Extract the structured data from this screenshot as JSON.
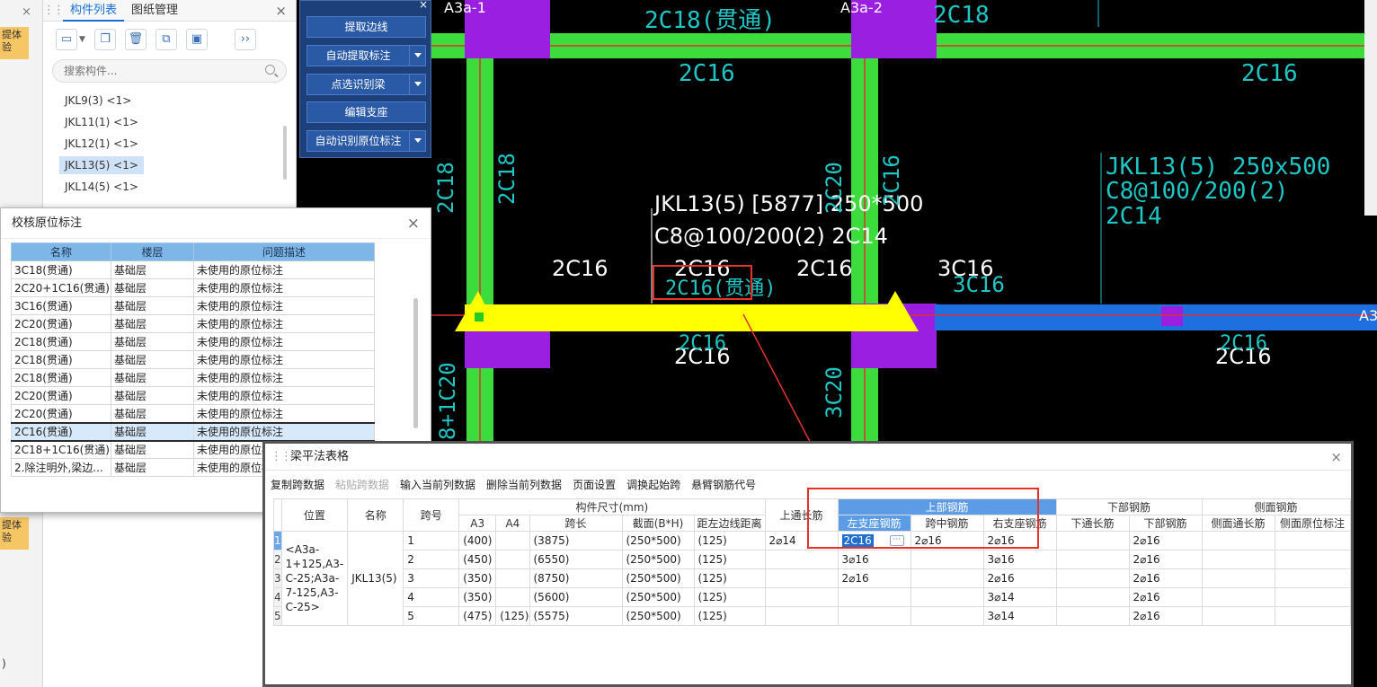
{
  "left_strip": {
    "badges": [
      "提体验",
      "提体验"
    ],
    "close": "×",
    "bottom_fragment": ")"
  },
  "component_panel": {
    "tabs": [
      "构件列表",
      "图纸管理"
    ],
    "close": "×",
    "search_placeholder": "搜索构件...",
    "items": [
      "JKL9(3) <1>",
      "JKL11(1) <1>",
      "JKL12(1) <1>",
      "JKL13(5) <1>",
      "JKL14(5) <1>"
    ],
    "selected_index": 3
  },
  "cad_commands": {
    "close": "×",
    "buttons": [
      "提取边线",
      "自动提取标注",
      "点选识别梁",
      "编辑支座",
      "自动识别原位标注"
    ]
  },
  "cad": {
    "axis_labels": [
      "A3a-1",
      "A3a-2",
      "A3"
    ],
    "white_texts": [
      "JKL13(5) [5877] 250*500",
      "C8@100/200(2) 2C14",
      "2C16",
      "2C16",
      "2C16",
      "3C16",
      "2C16",
      "2C16"
    ],
    "cyan_texts": [
      "2C18(贯通)",
      "2C18",
      "2C16",
      "2C16",
      "JKL13(5) 250x500",
      "C8@100/200(2)",
      "2C14",
      "2C18",
      "2C18",
      "2C20",
      "2C16",
      "2C16(贯通)",
      "3C16",
      "2C16",
      "2C16",
      "8+1C20",
      "3C20"
    ]
  },
  "check_dialog": {
    "title": "校核原位标注",
    "close": "×",
    "headers": [
      "名称",
      "楼层",
      "问题描述"
    ],
    "rows": [
      [
        "3C18(贯通)",
        "基础层",
        "未使用的原位标注"
      ],
      [
        "2C20+1C16(贯通)",
        "基础层",
        "未使用的原位标注"
      ],
      [
        "3C16(贯通)",
        "基础层",
        "未使用的原位标注"
      ],
      [
        "2C20(贯通)",
        "基础层",
        "未使用的原位标注"
      ],
      [
        "2C18(贯通)",
        "基础层",
        "未使用的原位标注"
      ],
      [
        "2C18(贯通)",
        "基础层",
        "未使用的原位标注"
      ],
      [
        "2C18(贯通)",
        "基础层",
        "未使用的原位标注"
      ],
      [
        "2C20(贯通)",
        "基础层",
        "未使用的原位标注"
      ],
      [
        "2C20(贯通)",
        "基础层",
        "未使用的原位标注"
      ],
      [
        "2C16(贯通)",
        "基础层",
        "未使用的原位标注"
      ],
      [
        "2C18+1C16(贯通)",
        "基础层",
        "未使用的原位标注"
      ],
      [
        "2.除注明外,梁边...",
        "基础层",
        "未使用的原位标注"
      ]
    ],
    "selected_index": 9
  },
  "beam_table": {
    "title": "梁平法表格",
    "close": "×",
    "menu": [
      "复制跨数据",
      "粘贴跨数据",
      "输入当前列数据",
      "删除当前列数据",
      "页面设置",
      "调换起始跨",
      "悬臂钢筋代号"
    ],
    "menu_disabled_index": 1,
    "headers": {
      "position": "位置",
      "name": "名称",
      "span_no": "跨号",
      "size_group": "构件尺寸(mm)",
      "a3": "A3",
      "a4": "A4",
      "span_len": "跨长",
      "section": "截面(B*H)",
      "edge_dist": "距左边线距离",
      "top_through": "上通长筋",
      "top_group": "上部钢筋",
      "left_support": "左支座钢筋",
      "mid_span": "跨中钢筋",
      "right_support": "右支座钢筋",
      "bottom_group": "下部钢筋",
      "bottom_through": "下通长筋",
      "bottom_bar": "下部钢筋",
      "side_group": "侧面钢筋",
      "side_through": "侧面通长筋",
      "side_inplace": "侧面原位标注"
    },
    "position_value": "<A3a-1+125,A3-C-25;A3a-7-125,A3-C-25>",
    "name_value": "JKL13(5)",
    "rows": [
      {
        "num": "1",
        "span": "1",
        "a3": "(400)",
        "a4": "",
        "len": "(3875)",
        "sec": "(250*500)",
        "dist": "(125)",
        "top": "2⌀14",
        "left": "2C16",
        "mid": "2⌀16",
        "right": "2⌀16",
        "bthru": "",
        "bottom": "2⌀16"
      },
      {
        "num": "2",
        "span": "2",
        "a3": "(450)",
        "a4": "",
        "len": "(6550)",
        "sec": "(250*500)",
        "dist": "(125)",
        "top": "",
        "left": "3⌀16",
        "mid": "",
        "right": "3⌀16",
        "bthru": "",
        "bottom": "2⌀16"
      },
      {
        "num": "3",
        "span": "3",
        "a3": "(350)",
        "a4": "",
        "len": "(8750)",
        "sec": "(250*500)",
        "dist": "(125)",
        "top": "",
        "left": "2⌀16",
        "mid": "",
        "right": "2⌀16",
        "bthru": "",
        "bottom": "2⌀16"
      },
      {
        "num": "4",
        "span": "4",
        "a3": "(350)",
        "a4": "",
        "len": "(5600)",
        "sec": "(250*500)",
        "dist": "(125)",
        "top": "",
        "left": "",
        "mid": "",
        "right": "3⌀14",
        "bthru": "",
        "bottom": "2⌀16"
      },
      {
        "num": "5",
        "span": "5",
        "a3": "(475)",
        "a4": "(125)",
        "len": "(5575)",
        "sec": "(250*500)",
        "dist": "(125)",
        "top": "",
        "left": "",
        "mid": "",
        "right": "3⌀14",
        "bthru": "",
        "bottom": "2⌀16"
      }
    ]
  },
  "colors": {
    "beam_green": "#3ddc3d",
    "column_purple": "#9a1fe0",
    "highlight_yellow": "#ffff00",
    "annotation_red": "#e5332a",
    "header_blue": "#5c9ce6"
  }
}
